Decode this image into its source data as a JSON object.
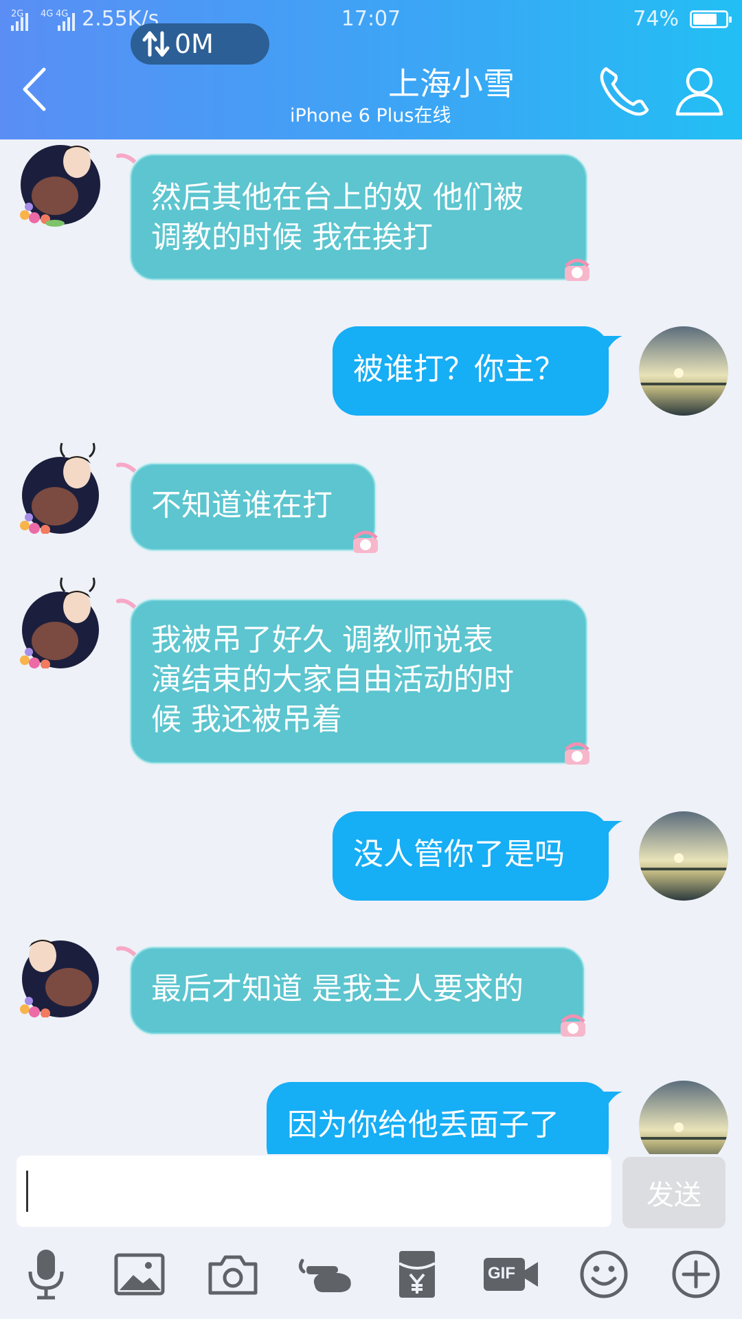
{
  "status_bar": {
    "network_left": "2G",
    "network_right": "4G",
    "network_right2": "4G",
    "speed": "2.55K/s",
    "time": "17:07",
    "battery": "74%",
    "battery_level": 0.74,
    "data_usage": "0M"
  },
  "header": {
    "title": "上海小雪",
    "subtitle": "iPhone 6 Plus在线"
  },
  "messages": [
    {
      "side": "in",
      "lines": [
        "然后其他在台上的奴 他们被",
        "调教的时候 我在挨打"
      ]
    },
    {
      "side": "out",
      "lines": [
        "被谁打？你主？"
      ]
    },
    {
      "side": "in",
      "lines": [
        "不知道谁在打"
      ]
    },
    {
      "side": "in",
      "lines": [
        "我被吊了好久  调教师说表",
        "演结束的大家自由活动的时",
        "候  我还被吊着"
      ]
    },
    {
      "side": "out",
      "lines": [
        "没人管你了是吗"
      ]
    },
    {
      "side": "in",
      "lines": [
        "最后才知道 是我主人要求的"
      ]
    },
    {
      "side": "out",
      "lines": [
        "因为你给他丢面子了"
      ]
    }
  ],
  "input": {
    "value": "",
    "send_label": "发送"
  },
  "toolbar": {
    "gif_label": "GIF"
  },
  "colors": {
    "header_start": "#5a8ef5",
    "header_end": "#22bff4",
    "incoming_bubble": "#5cc5cf",
    "outgoing_bubble": "#16aef5",
    "background": "#eef1f8"
  }
}
